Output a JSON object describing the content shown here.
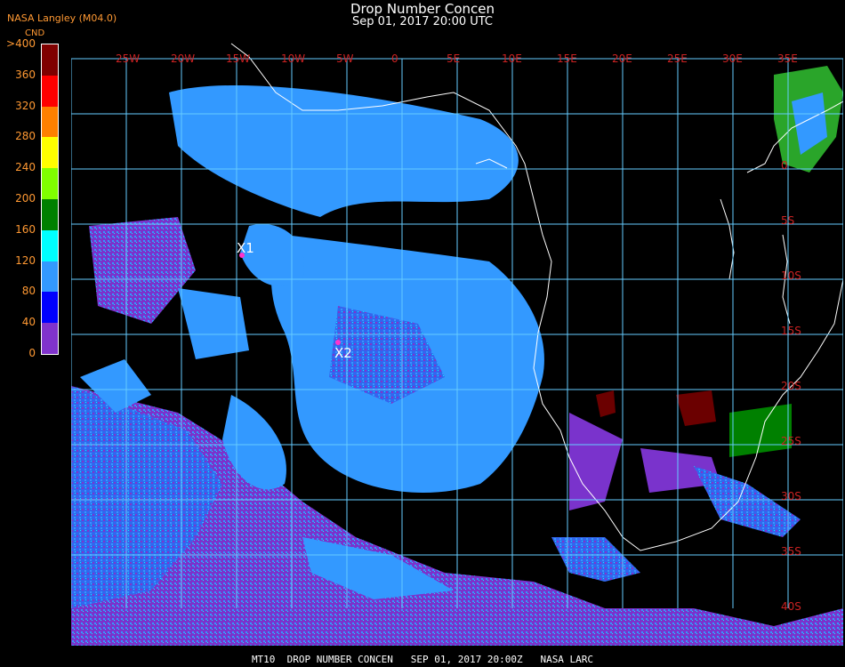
{
  "header": {
    "agency": "NASA Langley (M04.0)",
    "title": "Drop Number Concen",
    "subtitle": "Sep 01, 2017 20:00 UTC"
  },
  "colorbar": {
    "units": "CND",
    "ticks": [
      ">400",
      "360",
      "320",
      "280",
      "240",
      "200",
      "160",
      "120",
      "80",
      "40",
      "0"
    ],
    "colors": [
      "#7f0000",
      "#ff0000",
      "#ff8000",
      "#ffff00",
      "#80ff00",
      "#008000",
      "#00ffff",
      "#3399ff",
      "#0000ff",
      "#8033cc"
    ]
  },
  "map": {
    "lon_labels": [
      "25W",
      "20W",
      "15W",
      "10W",
      "5W",
      "0",
      "5E",
      "10E",
      "15E",
      "20E",
      "25E",
      "30E",
      "35E"
    ],
    "lat_labels": [
      "0",
      "5S",
      "10S",
      "15S",
      "20S",
      "25S",
      "30S",
      "35S",
      "40S"
    ],
    "markers": [
      {
        "label": "X1"
      },
      {
        "label": "X2"
      }
    ],
    "grid_color": "#66ccff",
    "coast_color": "#ffffff",
    "label_color": "#cc2222"
  },
  "footer": {
    "text": "MT10  DROP NUMBER CONCEN   SEP 01, 2017 20:00Z   NASA LARC"
  }
}
